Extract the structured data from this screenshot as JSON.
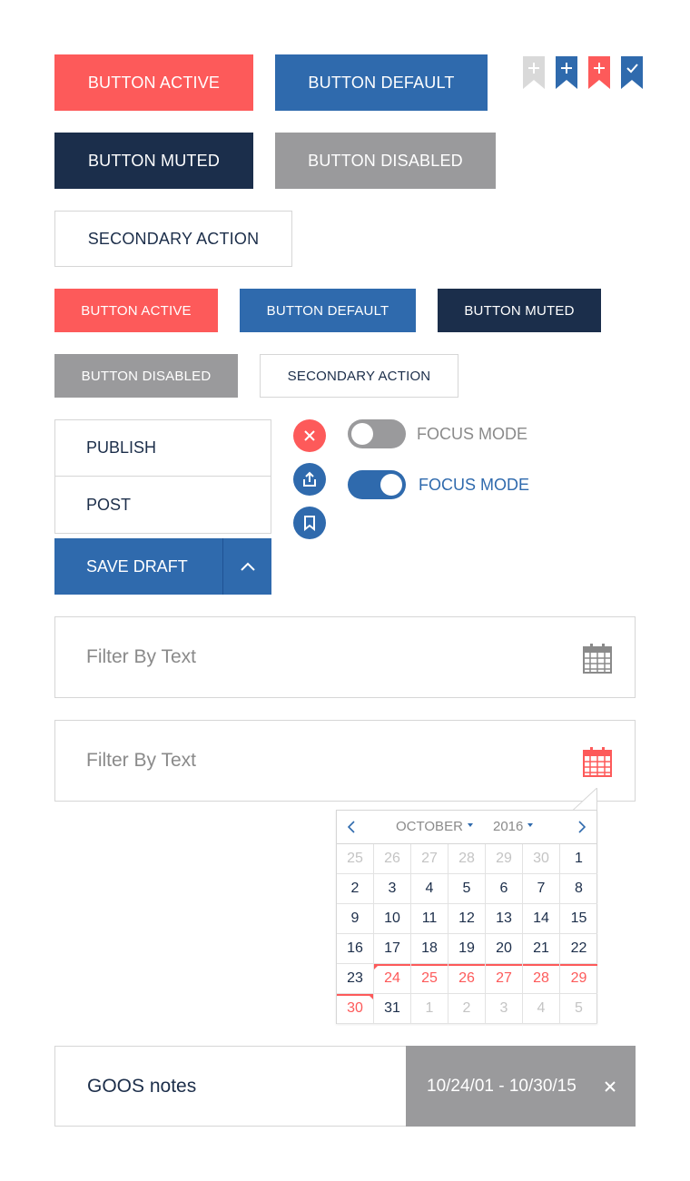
{
  "buttons_large": {
    "active": "BUTTON ACTIVE",
    "default": "BUTTON DEFAULT",
    "muted": "BUTTON MUTED",
    "disabled": "BUTTON DISABLED",
    "secondary": "SECONDARY ACTION"
  },
  "buttons_small": {
    "active": "BUTTON ACTIVE",
    "default": "BUTTON DEFAULT",
    "muted": "BUTTON MUTED",
    "disabled": "BUTTON DISABLED",
    "secondary": "SECONDARY ACTION"
  },
  "ribbons": [
    {
      "icon": "plus-icon",
      "state": "disabled",
      "color": "#d9d9d9"
    },
    {
      "icon": "plus-icon",
      "state": "default",
      "color": "#2f6aad"
    },
    {
      "icon": "plus-icon",
      "state": "active",
      "color": "#fd5a5a"
    },
    {
      "icon": "check-icon",
      "state": "default",
      "color": "#2f6aad"
    }
  ],
  "menu": {
    "items": [
      "PUBLISH",
      "POST"
    ],
    "save_label": "SAVE DRAFT",
    "caret_icon": "chevron-up-icon"
  },
  "action_icons": [
    "close-icon",
    "share-icon",
    "bookmark-icon"
  ],
  "toggles": [
    {
      "label": "FOCUS MODE",
      "on": false
    },
    {
      "label": "FOCUS MODE",
      "on": true
    }
  ],
  "filters": [
    {
      "placeholder": "Filter By Text",
      "icon": "calendar-icon",
      "icon_color": "#8a8a8a"
    },
    {
      "placeholder": "Filter By Text",
      "icon": "calendar-icon",
      "icon_color": "#fd5a5a"
    }
  ],
  "calendar": {
    "month": "OCTOBER",
    "year": "2016",
    "weeks": [
      [
        "25",
        "26",
        "27",
        "28",
        "29",
        "30",
        "1"
      ],
      [
        "2",
        "3",
        "4",
        "5",
        "6",
        "7",
        "8"
      ],
      [
        "9",
        "10",
        "11",
        "12",
        "13",
        "14",
        "15"
      ],
      [
        "16",
        "17",
        "18",
        "19",
        "20",
        "21",
        "22"
      ],
      [
        "23",
        "24",
        "25",
        "26",
        "27",
        "28",
        "29"
      ],
      [
        "30",
        "31",
        "1",
        "2",
        "3",
        "4",
        "5"
      ]
    ]
  },
  "tag": {
    "name": "GOOS notes",
    "range": "10/24/01 - 10/30/15"
  },
  "colors": {
    "active": "#fd5a5a",
    "default": "#2f6aad",
    "muted": "#1b2e4b",
    "disabled": "#9a9a9c",
    "border": "#d6d6d6"
  }
}
